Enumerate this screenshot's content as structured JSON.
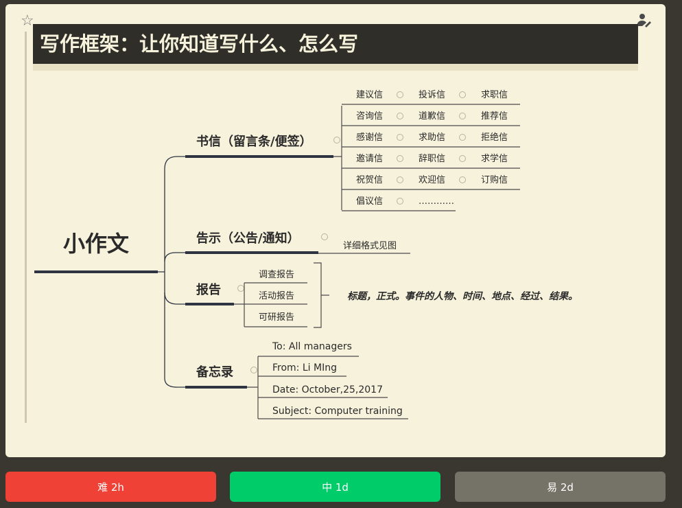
{
  "title": "写作框架：让你知道写什么、怎么写",
  "mindmap": {
    "root": "小作文",
    "branches": {
      "letter": "书信（留言条/便签）",
      "notice": "告示（公告/通知）",
      "report": "报告",
      "memo": "备忘录"
    },
    "letters": [
      [
        "建议信",
        "投诉信",
        "求职信"
      ],
      [
        "咨询信",
        "道歉信",
        "推荐信"
      ],
      [
        "感谢信",
        "求助信",
        "拒绝信"
      ],
      [
        "邀请信",
        "辞职信",
        "求学信"
      ],
      [
        "祝贺信",
        "欢迎信",
        "订购信"
      ],
      [
        "倡议信",
        "…………"
      ]
    ],
    "notice_detail": "详细格式见图",
    "reports": [
      "调查报告",
      "活动报告",
      "可研报告"
    ],
    "report_note": "标题，正式。事件的人物、时间、地点、经过、结果。",
    "memo_items": [
      "To: All managers",
      "From: Li MIng",
      "Date: October,25,2017",
      "Subject: Computer training"
    ]
  },
  "buttons": {
    "hard": "难 2h",
    "medium": "中 1d",
    "easy": "易 2d"
  }
}
